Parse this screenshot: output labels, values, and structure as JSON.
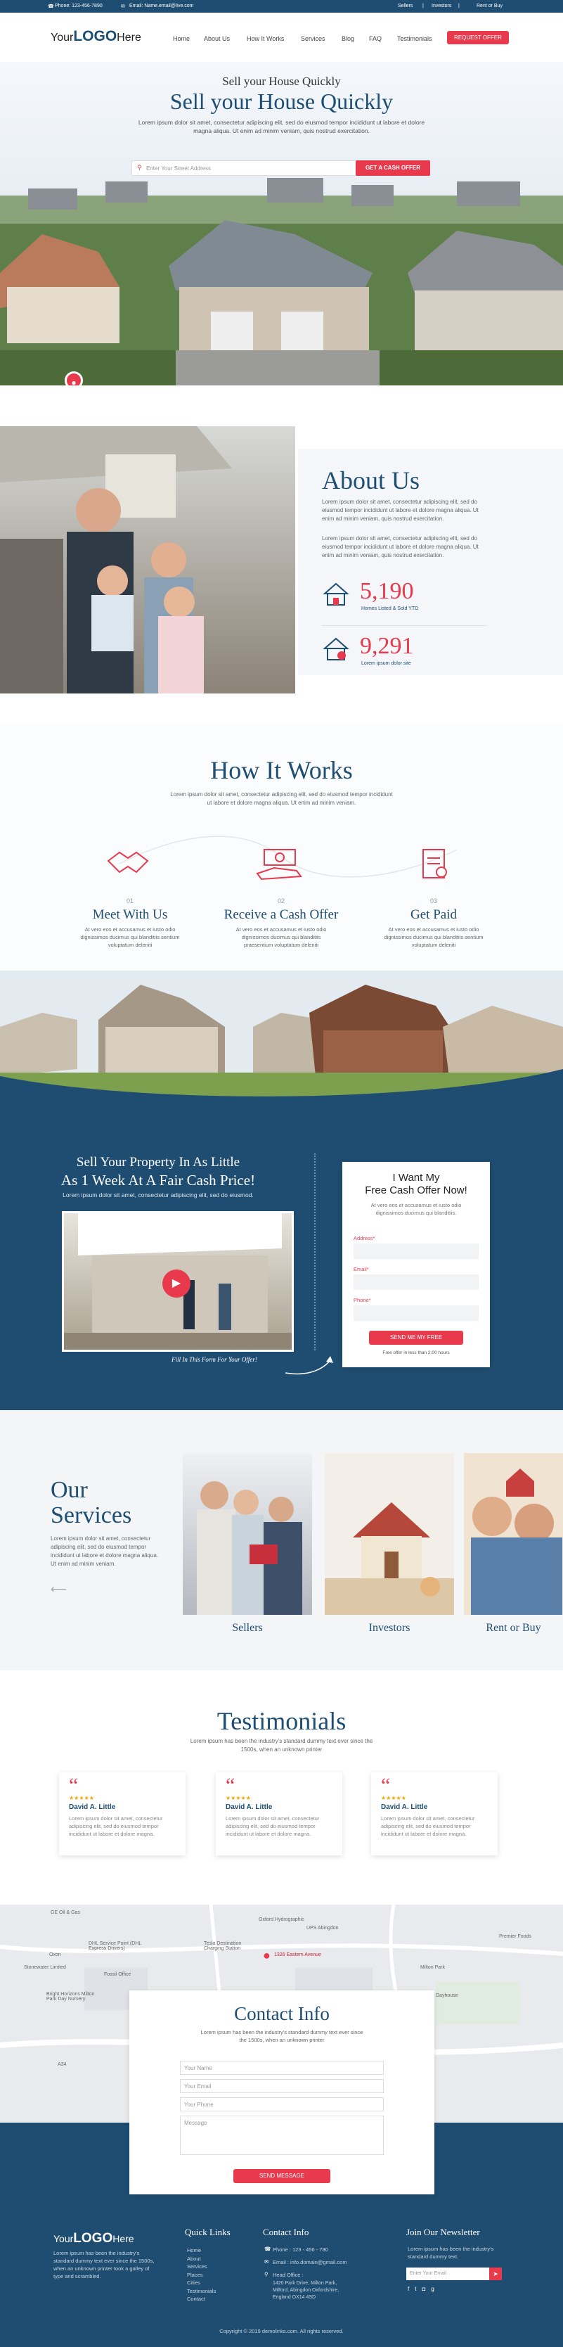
{
  "topbar": {
    "phone": "Phone: 123-456-7890",
    "email": "Email: Name.email@live.com",
    "links": [
      "Sellers",
      "|",
      "Investors",
      "|",
      "Rent or Buy"
    ]
  },
  "header": {
    "logo_your": "Your",
    "logo_logo": "LOGO",
    "logo_here": "Here",
    "nav": [
      "Home",
      "About Us",
      "How It Works",
      "Services",
      "Blog",
      "FAQ",
      "Testimonials"
    ],
    "cta": "REQUEST OFFER"
  },
  "hero": {
    "small_title": "Sell your House Quickly",
    "title": "Sell your House Quickly",
    "text": "Lorem ipsum dolor sit amet, consectetur adipiscing elit, sed do eiusmod tempor incididunt ut labore et dolore magna aliqua. Ut enim ad minim veniam, quis nostrud exercitation.",
    "placeholder": "Enter Your Street Address",
    "button": "GET A CASH OFFER"
  },
  "about": {
    "title": "About Us",
    "p1": "Lorem ipsum dolor sit amet, consectetur adipiscing elit, sed do eiusmod tempor incididunt ut labore et dolore magna aliqua. Ut enim ad minim veniam, quis nostrud exercitation.",
    "p2": "Lorem ipsum dolor sit amet, consectetur adipiscing elit, sed do eiusmod tempor incididunt ut labore et dolore magna aliqua. Ut enim ad minim veniam, quis nostrud exercitation.",
    "stat1_value": "5,190",
    "stat1_label": "Homes Listed & Sold YTD",
    "stat2_value": "9,291",
    "stat2_label": "Lorem ipsum dolor site"
  },
  "how": {
    "title": "How It Works",
    "text": "Lorem ipsum dolor sit amet, consectetur adipiscing elit, sed do eiusmod tempor incididunt ut labore et dolore magna aliqua. Ut enim ad minim veniam.",
    "steps": [
      {
        "num": "01",
        "title": "Meet With Us",
        "text": "At vero eos et accusamus et iusto odio dignissimos ducimus qui blanditiis sentium voluptatum deleniti"
      },
      {
        "num": "02",
        "title": "Receive a Cash Offer",
        "text": "At vero eos et accusamus et iusto odio dignissimos ducimus qui blanditiis praesentium voluptatum deleniti"
      },
      {
        "num": "03",
        "title": "Get Paid",
        "text": "At vero eos et accusamus et iusto odio dignissimos ducimus qui blanditiis sentium voluptatum deleniti"
      }
    ]
  },
  "sell": {
    "title1": "Sell Your Property In As Little",
    "title2": "As 1 Week At A Fair Cash Price!",
    "text": "Lorem ipsum dolor sit amet, consectetur adipiscing elit, sed do eiusmod.",
    "caption": "Fill In This Form For Your Offer!"
  },
  "offer_form": {
    "title1": "I Want My",
    "title2": "Free Cash Offer Now!",
    "text": "At vero eos et accusamus et iusto odio dignissimos ducimus qui blanditiis.",
    "address_label": "Address*",
    "email_label": "Email*",
    "phone_label": "Phone*",
    "button": "SEND ME MY FREE",
    "note": "Free offer in less than 2:00 hours"
  },
  "services": {
    "title1": "Our",
    "title2": "Services",
    "text": "Lorem ipsum dolor sit amet, consectetur adipiscing elit, sed do eiusmod tempor incididunt ut labore et dolore magna aliqua. Ut enim ad minim veniam.",
    "items": [
      "Sellers",
      "Investors",
      "Rent or Buy"
    ]
  },
  "testimonials": {
    "title": "Testimonials",
    "text": "Lorem ipsum has been the industry's standard dummy text ever since the 1500s, when an unknown printer",
    "items": [
      {
        "name": "David A. Little",
        "stars": "★★★★★",
        "text": "Lorem ipsum dolor sit amet, consectetur adipiscing elit, sed do eiusmod tempor incididunt ut labore et dolore magna."
      },
      {
        "name": "David A. Little",
        "stars": "★★★★★",
        "text": "Lorem ipsum dolor sit amet, consectetur adipiscing elit, sed do eiusmod tempor incididunt ut labore et dolore magna."
      },
      {
        "name": "David A. Little",
        "stars": "★★★★★",
        "text": "Lorem ipsum dolor sit amet, consectetur adipiscing elit, sed do eiusmod tempor incididunt ut labore et dolore magna."
      }
    ]
  },
  "map": {
    "pin_label": "1326 Eastern Avenue",
    "places": [
      "GE Oil & Gas",
      "Oxford Hydrographic",
      "UPS Abingdon",
      "Tesla Destination Charging Station",
      "DHL Service Point (DHL Express Drivers)",
      "Oxon",
      "Stonewater Limited",
      "Fossil Office",
      "Bright Horizons Milton Park Day Nursery",
      "Premier Foods",
      "Milton Park",
      "Dayhouse",
      "A34"
    ]
  },
  "contact": {
    "title": "Contact Info",
    "text": "Lorem ipsum has been the industry's standard dummy text ever since the 1500s, when an unknown printer",
    "name_ph": "Your Name",
    "email_ph": "Your Email",
    "phone_ph": "Your Phone",
    "message_ph": "Message",
    "button": "SEND MESSAGE"
  },
  "footer": {
    "about": "Lorem ipsum has been the industry's standard dummy text ever since the 1500s, when an unknown printer took a galley of type and scrambled.",
    "quick_title": "Quick Links",
    "quick_links": [
      "Home",
      "About",
      "Services",
      "Places",
      "Cities",
      "Testimonials",
      "Contact"
    ],
    "contact_title": "Contact Info",
    "phone": "Phone : 123 - 456 - 780",
    "email": "Email : info.domain@gmail.com",
    "office_label": "Head Office :",
    "office_address": "1420 Park Drive, Milton Park, Milford, Abingdon Oxfordshire, England OX14 4SD",
    "newsletter_title": "Join Our Newsletter",
    "newsletter_text": "Lorem ipsum has been the industry's standard dummy text.",
    "newsletter_ph": "Enter Your Email",
    "copyright": "Copyright © 2019 demolinks.com. All rights reserved."
  },
  "colors": {
    "navy": "#1d4e73",
    "red": "#e83a4c",
    "dark": "#1e4d71"
  }
}
